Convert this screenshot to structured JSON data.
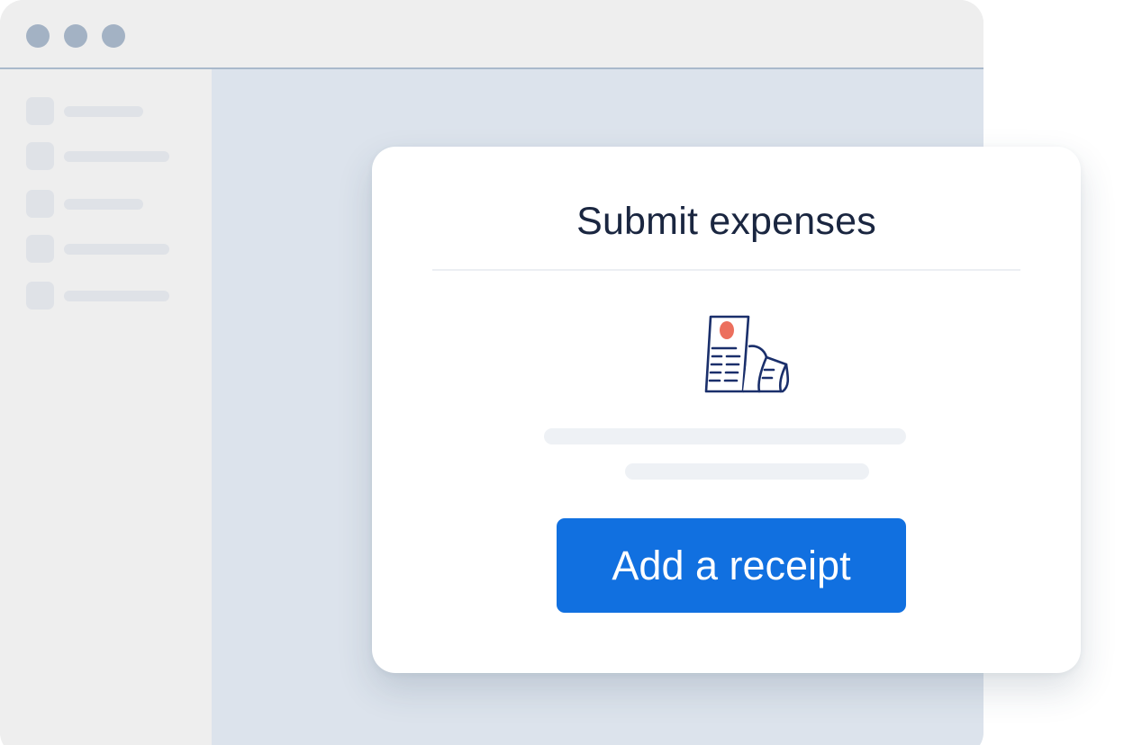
{
  "colors": {
    "window_dot": "#a3b2c4",
    "button_bg": "#1170e0",
    "receipt_stroke": "#1a2f6b",
    "receipt_accent": "#ec6f5d"
  },
  "icons": {
    "receipt": "receipt-icon"
  },
  "dialog": {
    "title": "Submit expenses",
    "button_label": "Add a receipt"
  }
}
